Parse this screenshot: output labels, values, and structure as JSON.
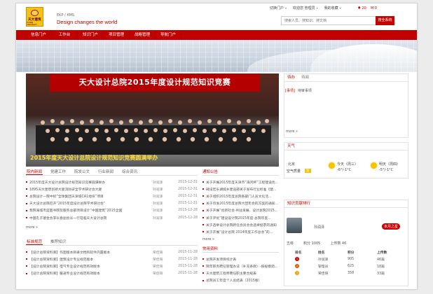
{
  "header": {
    "logo_text": "天大建筑",
    "logo_sub": "TIANJIN UNIVERSITY",
    "system_name": "EKP / KMS",
    "slogan": "Design changes the world",
    "top_links": [
      {
        "label": "切换门户",
        "caret": true
      },
      {
        "label": "欢迎您 管理员",
        "caret": true
      },
      {
        "label": "我的收藏",
        "caret": true
      }
    ],
    "notif": [
      {
        "icon": "bell",
        "count": "20"
      },
      {
        "icon": "mail",
        "count": "0"
      }
    ],
    "search_placeholder": "搜索人员、搜知识、搜文档",
    "search_button": "搜全系统"
  },
  "nav": [
    "信息门户",
    "工作台",
    "知识门户",
    "项目管理",
    "战略管理",
    "导航门户"
  ],
  "hero": {
    "banner_title": "天大设计总院2015年度设计规范知识竞赛",
    "caption": "2015年度天大设计总院设计规范知识竞赛圆满举办"
  },
  "news": {
    "tabs": [
      {
        "label": "院内新闻",
        "active": true
      },
      {
        "label": "党建工作",
        "active": false
      },
      {
        "label": "院发公文",
        "active": false
      },
      {
        "label": "行业新闻",
        "active": false
      },
      {
        "label": "综合资讯",
        "active": false
      }
    ],
    "items": [
      {
        "title": "2015年度天大设计总院设计规范知识竞赛圆满举办",
        "author": "孙润泽",
        "date": "2015-12-31"
      },
      {
        "title": "1895天大建筑创新大厦消防安全学术研讨会大厦",
        "author": "孙润泽",
        "date": "2015-12-31"
      },
      {
        "title": "总院设计一院中标“全球集团天津城CA1地块”项目",
        "author": "孙润泽",
        "date": "2015-12-31"
      },
      {
        "title": "天大设计总院召开“2015年度设计总院学术研讨会”",
        "author": "孙润泽",
        "date": "2015-12-31"
      },
      {
        "title": "我院海城市蓝图书院及服务总部项目设计“中国建筑”2015全国",
        "author": "孙润泽",
        "date": "2015-12-28"
      },
      {
        "title": "中国孔子基金会李长春副会长一行莅临天大设计总院",
        "author": "孙润泽",
        "date": "2015-12-28"
      }
    ],
    "more": "more"
  },
  "notice": {
    "title": "通知公告",
    "items": [
      "关于开展2015年度天津市“海河杯”工程建设优...",
      "碑设宏乐湖城乡建设部关于发布行业标准《建...",
      "关于组织2015年度总院各部门人员文化活...",
      "关于印发2015年度总院大团年会的方案的通知...",
      "关于开展“创新社会·共驻发展、设计总院2015...",
      "关于评优“建设设计院2015年度·总院年度...",
      "关于选举设计总院新任会员会会选举投票的通知",
      "关于开展“设计总院 2014年度工作总会”的..."
    ],
    "more": "more"
  },
  "standards": {
    "tabs": [
      {
        "label": "标准规范",
        "active": true
      },
      {
        "label": "推荐知识",
        "active": false
      }
    ],
    "items": [
      {
        "title": "【设计总院资料库】作图版本目录文档和软件内置版本",
        "author": "荣佳琦",
        "date": "2015-11-28"
      },
      {
        "title": "【设计总院资料库】建筑设计专业规范版本",
        "author": "荣佳琦",
        "date": "2015-11-28"
      },
      {
        "title": "【设计总院资料库】电气专业设计规范有效版本",
        "author": "荣佳琦",
        "date": "2015-11-28"
      },
      {
        "title": "【设计总院资料库】暖通专业设计规范有效版本",
        "author": "荣佳琦",
        "date": "2015-11-28"
      }
    ]
  },
  "common_docs": {
    "title": "常用资料",
    "items": [
      "总院开发项目统计表",
      "院年职务聘任管理办法（补充条款）-按规模调...",
      "天大建筑工程师聘任职主要合规表",
      "总院员工年度个人总结表（2015版）"
    ]
  },
  "todo": {
    "tabs": [
      {
        "label": "待办",
        "active": true
      },
      {
        "label": "待阅",
        "active": false
      }
    ],
    "item_badge": "[事项]",
    "item_text": "待审事项",
    "more": "more"
  },
  "weather": {
    "title": "天气",
    "city": "北京",
    "city_sub": "空气质量",
    "city_badge": "良",
    "today": {
      "label": "今天（周三）",
      "temp": "-6°/-1°C"
    },
    "tomorrow": {
      "label": "明天（周四）",
      "temp": "-5°/-1°C"
    }
  },
  "ranking": {
    "title": "知识贡献排行",
    "top_user": "孙润泽",
    "badge": "本月之星",
    "stats": [
      {
        "label": "五级",
        "value": ""
      },
      {
        "label": "积分 1005",
        "value": ""
      },
      {
        "label": "上传数 46",
        "value": ""
      }
    ],
    "headers": [
      "排名",
      "姓名",
      "积分",
      "上传数"
    ],
    "rows": [
      {
        "rank": "1",
        "name": "孙润泽",
        "points": "905",
        "uploads": "46篇"
      },
      {
        "rank": "2",
        "name": "管理员",
        "points": "625",
        "uploads": "18篇"
      },
      {
        "rank": "3",
        "name": "荣佳琦",
        "points": "358",
        "uploads": "33篇"
      }
    ]
  },
  "colors": {
    "brand_red": "#c10000",
    "accent": "#c80000",
    "logo_yellow": "#f0c21a"
  }
}
